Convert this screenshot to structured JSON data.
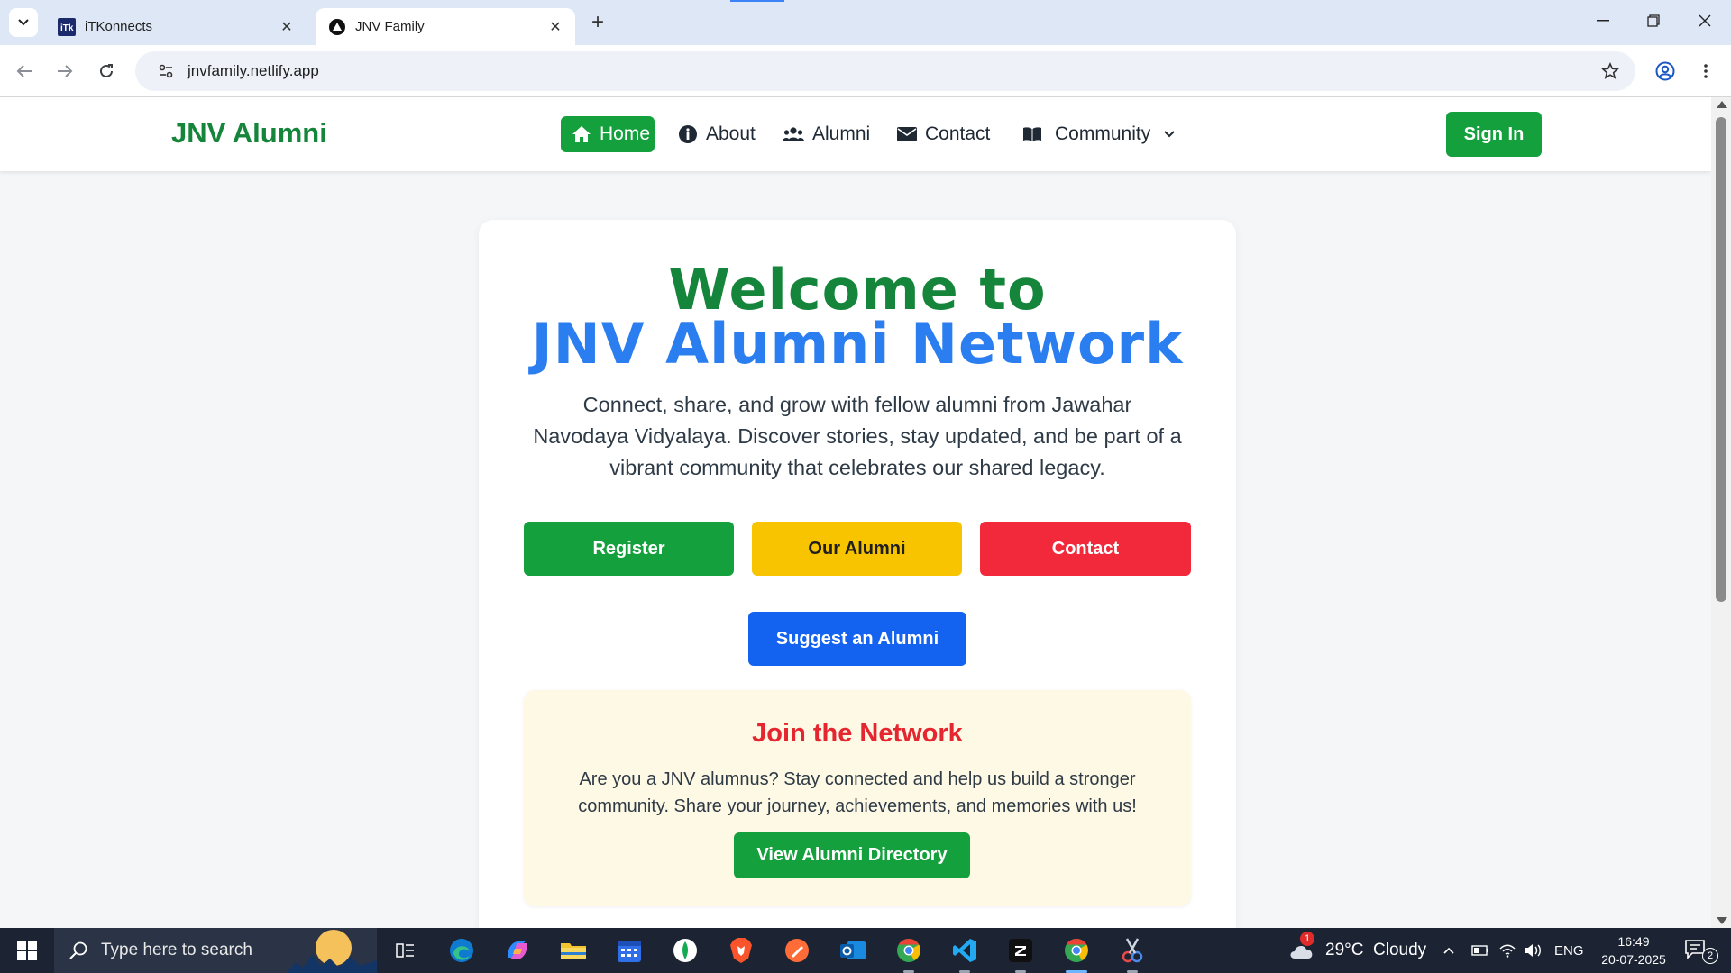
{
  "browser": {
    "tabs": [
      {
        "title": "iTKonnects",
        "favicon": "itk-favicon",
        "active": false
      },
      {
        "title": "JNV Family",
        "favicon": "netlify-favicon",
        "active": true
      }
    ],
    "url": "jnvfamily.netlify.app"
  },
  "site": {
    "brand": "JNV Alumni",
    "nav": {
      "home": "Home",
      "about": "About",
      "alumni": "Alumni",
      "contact": "Contact",
      "community": "Community"
    },
    "signin": "Sign In",
    "colors": {
      "primary_green": "#14a03c",
      "brand_green": "#14853a",
      "accent_blue": "#2b7ef0",
      "yellow": "#f8c400",
      "red": "#f2283b",
      "blue_button": "#1462f0"
    }
  },
  "hero": {
    "title_line1": "Welcome to",
    "title_line2": "JNV Alumni Network",
    "subtitle": "Connect, share, and grow with fellow alumni from Jawahar Navodaya Vidyalaya. Discover stories, stay updated, and be part of a vibrant community that celebrates our shared legacy.",
    "buttons": {
      "register": "Register",
      "our_alumni": "Our Alumni",
      "contact": "Contact",
      "suggest": "Suggest an Alumni"
    }
  },
  "join": {
    "title": "Join the Network",
    "text": "Are you a JNV alumnus? Stay connected and help us build a stronger community. Share your journey, achievements, and memories with us!",
    "button": "View Alumni Directory"
  },
  "taskbar": {
    "search_placeholder": "Type here to search",
    "weather": "29°C  Cloudy",
    "weather_badge": "1",
    "language": "ENG",
    "time": "16:49",
    "date": "20-07-2025",
    "notification_count": "2"
  }
}
